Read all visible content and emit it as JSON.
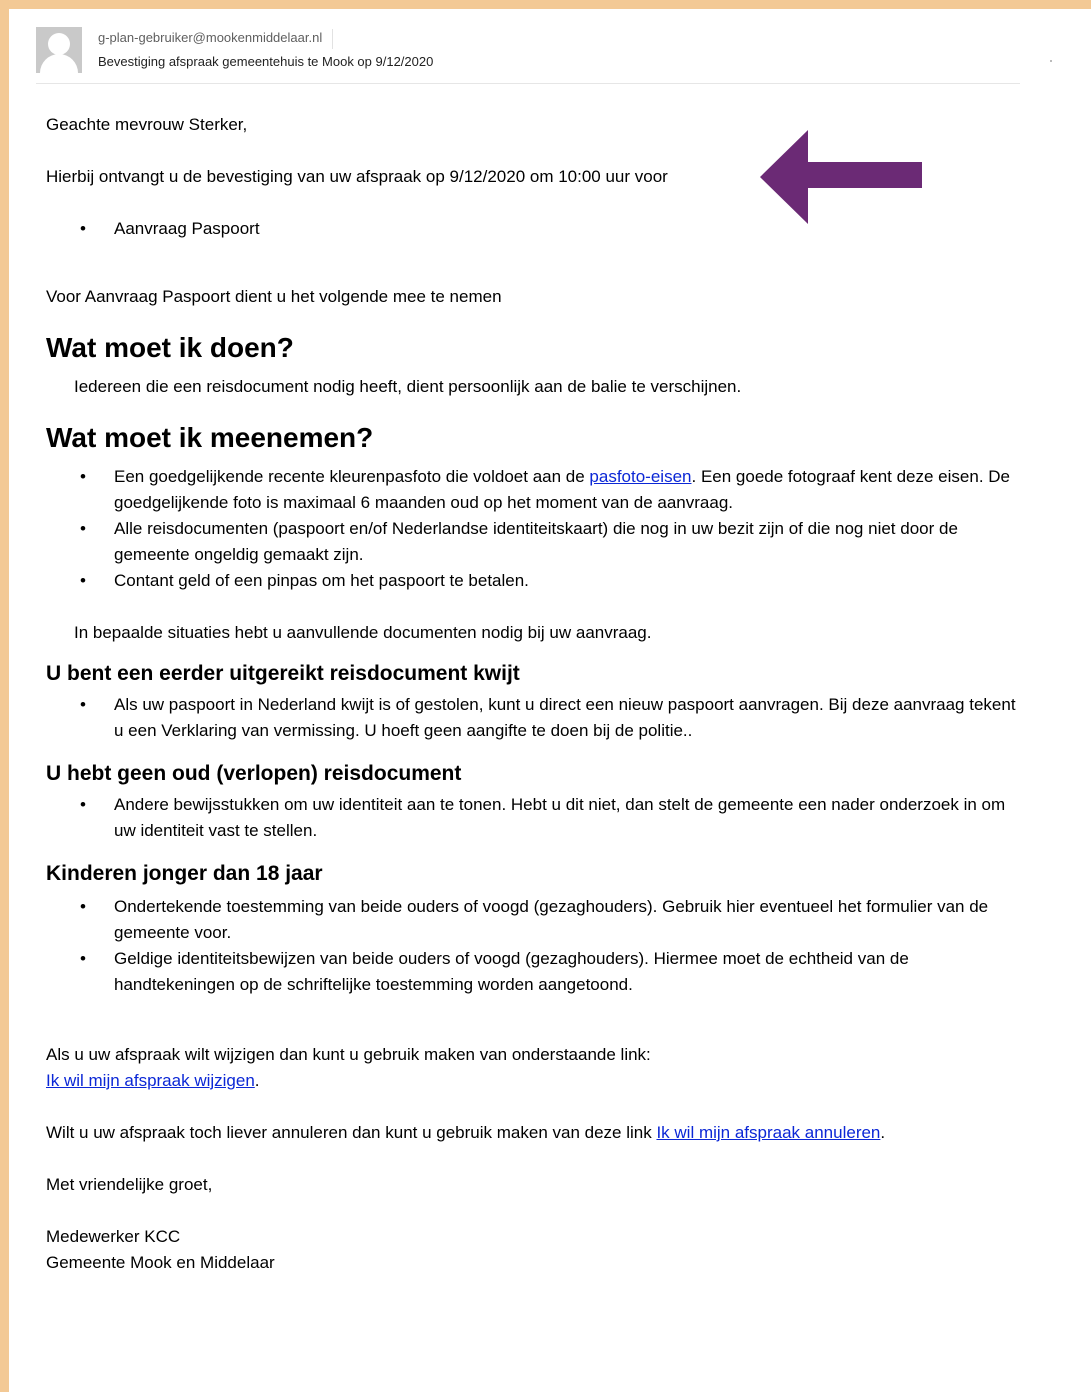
{
  "email": {
    "from": "g-plan-gebruiker@mookenmiddelaar.nl",
    "subject": "Bevestiging afspraak gemeentehuis te Mook op  9/12/2020",
    "accent_color": "#6b2a75",
    "frame_color": "#f3c995",
    "link_color": "#0b27d6"
  },
  "body": {
    "greeting": "Geachte mevrouw Sterker,",
    "confirmation": "Hierbij ontvangt u de bevestiging van uw afspraak op 9/12/2020 om 10:00 uur voor",
    "products": [
      "Aanvraag Paspoort"
    ],
    "bring_intro": "Voor Aanvraag Paspoort dient u het volgende mee te nemen",
    "what_to_do": {
      "heading": "Wat moet ik doen?",
      "text": "Iedereen die een reisdocument nodig heeft, dient persoonlijk aan de balie te verschijnen."
    },
    "what_to_bring": {
      "heading": "Wat moet ik meenemen?",
      "item1_before": "Een goedgelijkende recente kleurenpasfoto die voldoet aan de ",
      "item1_link": "pasfoto-eisen",
      "item1_after": ". Een goede fotograaf kent deze eisen. De goedgelijkende foto is maximaal 6 maanden oud op het moment van de aanvraag.",
      "item2": "Alle reisdocumenten (paspoort en/of Nederlandse identiteitskaart) die nog in uw bezit zijn of die nog niet door de gemeente ongeldig gemaakt zijn.",
      "item3": "Contant geld of een pinpas om het paspoort te betalen.",
      "note": "In bepaalde situaties hebt u aanvullende documenten nodig bij uw aanvraag."
    },
    "lost": {
      "heading": "U bent een eerder uitgereikt reisdocument kwijt",
      "item": "Als uw paspoort in Nederland kwijt is of gestolen, kunt u direct een nieuw paspoort aanvragen. Bij deze aanvraag tekent u een Verklaring van vermissing. U hoeft geen aangifte te doen bij de politie.."
    },
    "no_old": {
      "heading": "U hebt geen oud (verlopen) reisdocument",
      "item": "Andere bewijsstukken om uw identiteit aan te tonen. Hebt u dit niet, dan stelt de gemeente een nader onderzoek in om uw identiteit vast te stellen."
    },
    "children": {
      "heading": "Kinderen jonger dan 18 jaar",
      "item1": "Ondertekende toestemming van beide ouders of voogd (gezaghouders). Gebruik hier eventueel het formulier van de gemeente voor.",
      "item2": "Geldige identiteitsbewijzen van beide ouders of voogd (gezaghouders). Hiermee moet de echtheid van de handtekeningen op de schriftelijke toestemming worden aangetoond."
    },
    "change_text": "Als u uw afspraak wilt wijzigen dan kunt u gebruik maken van onderstaande link:",
    "change_link": "Ik wil mijn afspraak wijzigen",
    "cancel_text": "Wilt u uw afspraak toch liever annuleren dan kunt u gebruik maken van deze link ",
    "cancel_link": "Ik wil mijn afspraak annuleren",
    "closing": "Met vriendelijke groet,",
    "signature_name": "Medewerker KCC",
    "signature_org": "Gemeente Mook en Middelaar"
  },
  "icons": [
    "avatar-icon",
    "arrow-left-icon"
  ]
}
